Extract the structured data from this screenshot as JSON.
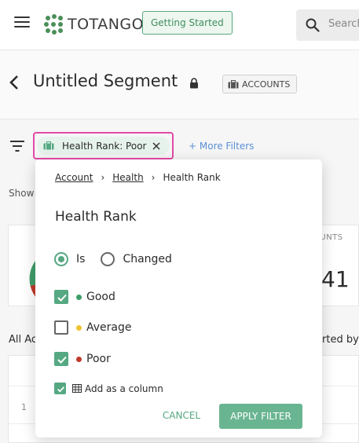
{
  "app": {
    "logo_text": "TOTANGO",
    "getting_started_label": "Getting Started",
    "search_placeholder": "Search",
    "icons": {
      "menu": "hamburger-icon",
      "search": "search-icon"
    }
  },
  "segment": {
    "title": "Untitled Segment",
    "scope_label": "ACCOUNTS",
    "icons": {
      "back": "chevron-left-icon",
      "lock": "lock-icon",
      "scope": "briefcase-icon"
    }
  },
  "filters": {
    "active_chip_label": "Health Rank: Poor",
    "more_filters_label": "+ More Filters",
    "icons": {
      "filter": "filter-lines-icon",
      "chip": "briefcase-icon",
      "remove": "close-icon"
    }
  },
  "background": {
    "show_text": "Show",
    "accounts_caption": "OUNTS",
    "count_fragment": "41",
    "all_accounts_text": "All Ac",
    "sorted_by_text": "rted by",
    "row_number": "1"
  },
  "popover": {
    "breadcrumb": [
      "Account",
      "Health",
      "Health Rank"
    ],
    "title": "Health Rank",
    "mode_options": [
      {
        "label": "Is",
        "selected": true
      },
      {
        "label": "Changed",
        "selected": false
      }
    ],
    "values": [
      {
        "label": "Good",
        "checked": true,
        "color": "#3f9d6a"
      },
      {
        "label": "Average",
        "checked": false,
        "color": "#f2c230"
      },
      {
        "label": "Poor",
        "checked": true,
        "color": "#c0392b"
      }
    ],
    "add_column_label": "Add as a column",
    "add_column_checked": true,
    "cancel_label": "CANCEL",
    "apply_label": "APPLY FILTER"
  },
  "colors": {
    "accent": "#55a882",
    "highlight_border": "#e24aa6",
    "link": "#5b8fd6"
  }
}
